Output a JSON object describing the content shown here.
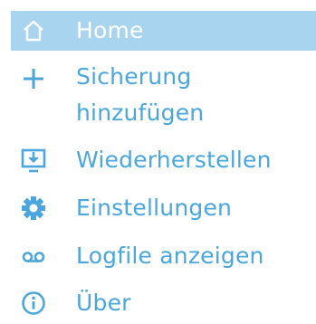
{
  "menu": {
    "items": [
      {
        "label": "Home",
        "icon": "home-icon",
        "active": true
      },
      {
        "label": "Sicherung",
        "label_line2": "hinzufügen",
        "icon": "plus-icon",
        "active": false
      },
      {
        "label": "Wiederherstellen",
        "icon": "monitor-download-icon",
        "active": false
      },
      {
        "label": "Einstellungen",
        "icon": "gear-icon",
        "active": false
      },
      {
        "label": "Logfile anzeigen",
        "icon": "voicemail-icon",
        "active": false
      },
      {
        "label": "Über",
        "icon": "info-icon",
        "active": false
      }
    ]
  },
  "colors": {
    "accent": "#4aa6dc",
    "active_background": "#a8d4ef",
    "active_text": "#ffffff",
    "background": "#ffffff"
  }
}
